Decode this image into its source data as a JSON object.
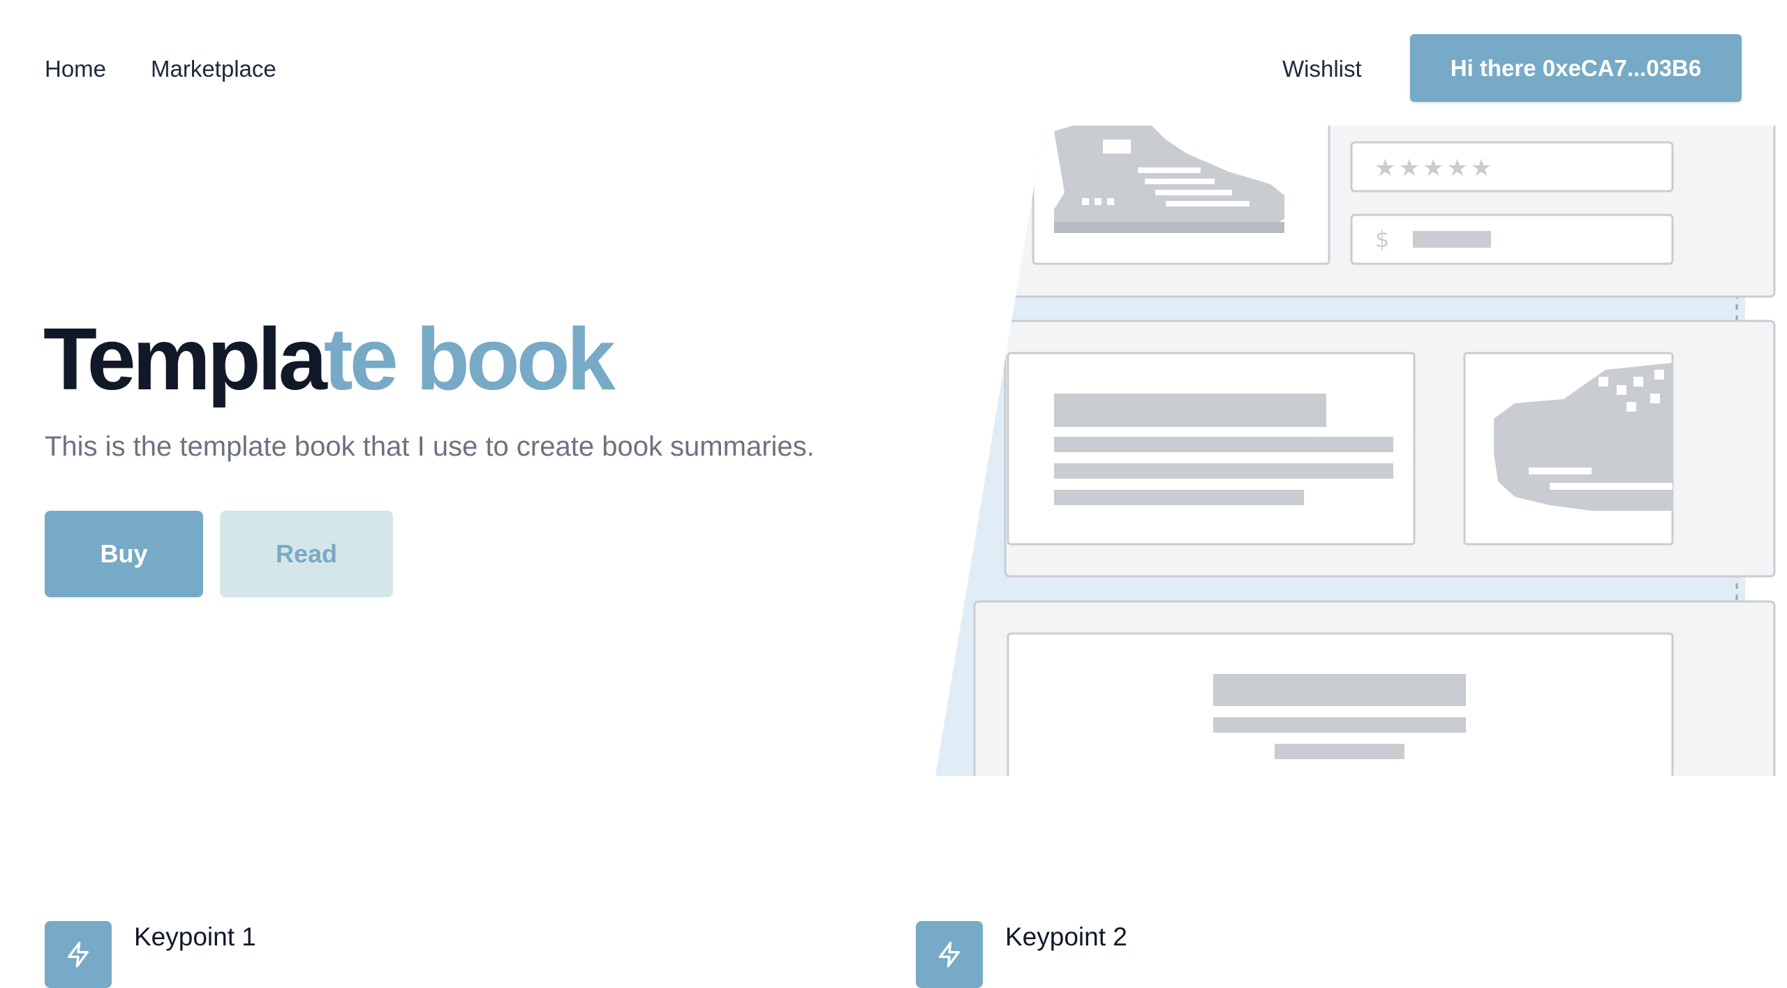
{
  "nav": {
    "home": "Home",
    "marketplace": "Marketplace",
    "wishlist": "Wishlist",
    "wallet_greeting": "Hi there 0xeCA7...03B6"
  },
  "hero": {
    "title_dark": "Templa",
    "title_accent": "te book",
    "subtitle": "This is the template book that I use to create book summaries.",
    "buy_label": "Buy",
    "read_label": "Read"
  },
  "illustration": {
    "stars": "★★★★★",
    "currency": "$"
  },
  "features": [
    {
      "title": "Keypoint 1",
      "icon": "lightning-icon"
    },
    {
      "title": "Keypoint 2",
      "icon": "lightning-icon"
    }
  ],
  "colors": {
    "accent": "#77aac6",
    "accent_light": "#d5e6ea",
    "heading": "#111827",
    "subtext": "#6b7280",
    "illustration_bg": "#e0edf6",
    "placeholder_gray": "#c9ccd0"
  }
}
